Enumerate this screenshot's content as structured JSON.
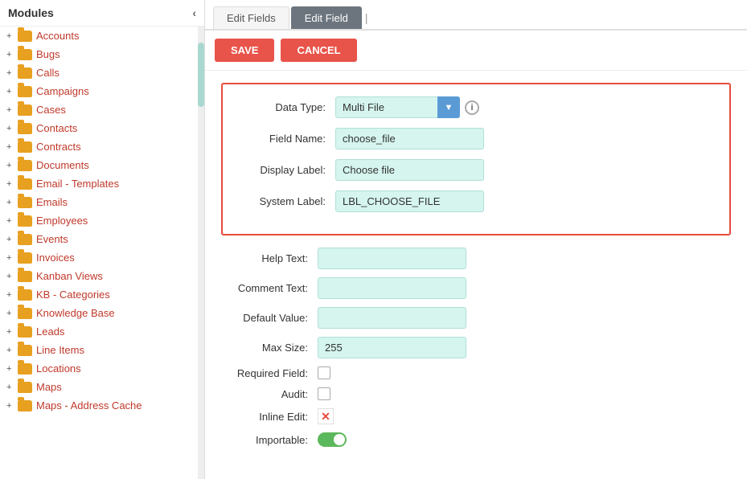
{
  "sidebar": {
    "header": "Modules",
    "toggle_icon": "‹",
    "items": [
      {
        "label": "Accounts"
      },
      {
        "label": "Bugs"
      },
      {
        "label": "Calls"
      },
      {
        "label": "Campaigns"
      },
      {
        "label": "Cases"
      },
      {
        "label": "Contacts"
      },
      {
        "label": "Contracts"
      },
      {
        "label": "Documents"
      },
      {
        "label": "Email - Templates"
      },
      {
        "label": "Emails"
      },
      {
        "label": "Employees"
      },
      {
        "label": "Events"
      },
      {
        "label": "Invoices"
      },
      {
        "label": "Kanban Views"
      },
      {
        "label": "KB - Categories"
      },
      {
        "label": "Knowledge Base"
      },
      {
        "label": "Leads"
      },
      {
        "label": "Line Items"
      },
      {
        "label": "Locations"
      },
      {
        "label": "Maps"
      },
      {
        "label": "Maps - Address Cache"
      }
    ]
  },
  "tabs": {
    "edit_fields": "Edit Fields",
    "edit_field": "Edit Field",
    "divider": "|"
  },
  "toolbar": {
    "save_label": "SAVE",
    "cancel_label": "CANCEL"
  },
  "form": {
    "data_type_label": "Data Type:",
    "data_type_value": "Multi File",
    "field_name_label": "Field Name:",
    "field_name_value": "choose_file",
    "display_label_label": "Display Label:",
    "display_label_value": "Choose file",
    "system_label_label": "System Label:",
    "system_label_value": "LBL_CHOOSE_FILE",
    "help_text_label": "Help Text:",
    "help_text_value": "",
    "comment_text_label": "Comment Text:",
    "comment_text_value": "",
    "default_value_label": "Default Value:",
    "default_value_value": "",
    "max_size_label": "Max Size:",
    "max_size_value": "255",
    "required_field_label": "Required Field:",
    "audit_label": "Audit:",
    "inline_edit_label": "Inline Edit:",
    "importable_label": "Importable:"
  },
  "icons": {
    "chevron_down": "▼",
    "info": "i",
    "expand": "+",
    "chevron_left": "‹",
    "x_mark": "✕"
  }
}
